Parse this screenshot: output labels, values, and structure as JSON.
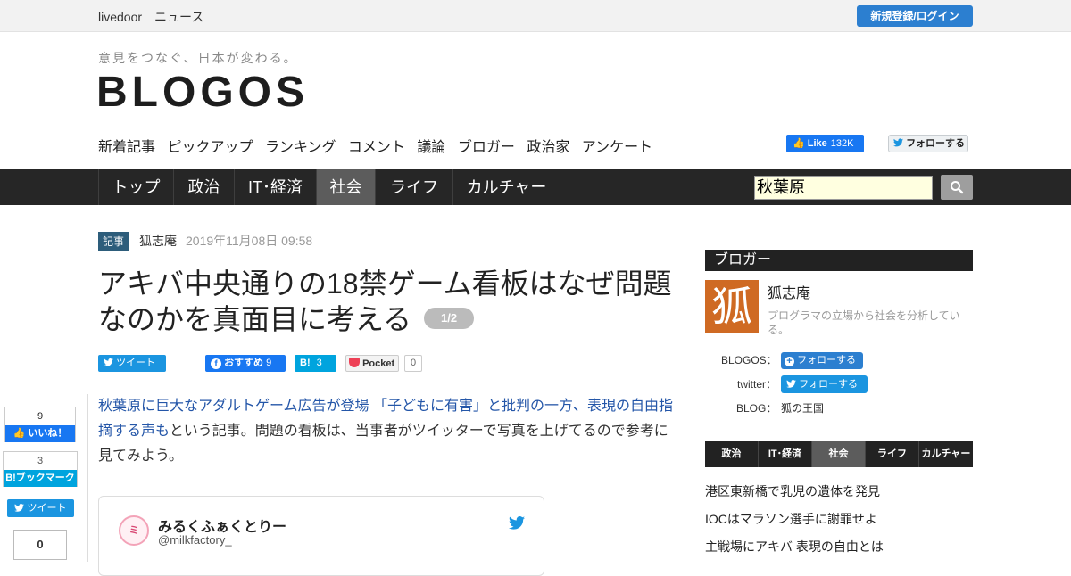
{
  "header": {
    "brand": "livedoor　ニュース",
    "login_label": "新規登録/ログイン",
    "tagline": "意見をつなぐ、日本が変わる。",
    "logo": "BLOGOS"
  },
  "subnav": [
    "新着記事",
    "ピックアップ",
    "ランキング",
    "コメント",
    "議論",
    "ブロガー",
    "政治家",
    "アンケート"
  ],
  "social": {
    "fb_like": "Like",
    "fb_count": "132K",
    "tw_follow": "フォローする"
  },
  "categories": [
    {
      "label": "トップ",
      "active": false
    },
    {
      "label": "政治",
      "active": false
    },
    {
      "label": "IT･経済",
      "active": false
    },
    {
      "label": "社会",
      "active": true
    },
    {
      "label": "ライフ",
      "active": false
    },
    {
      "label": "カルチャー",
      "active": false
    }
  ],
  "search": {
    "value": "秋葉原"
  },
  "article": {
    "tag": "記事",
    "author": "狐志庵",
    "date": "2019年11月08日 09:58",
    "title": "アキバ中央通りの18禁ゲーム看板はなぜ問題なのかを真面目に考える",
    "page": "1/2",
    "share": {
      "tweet": "ツイート",
      "fb_recommend": "おすすめ",
      "fb_count": "9",
      "hatena": "B!",
      "hatena_count": "3",
      "pocket": "Pocket",
      "pocket_count": "0"
    },
    "intro_link": "秋葉原に巨大なアダルトゲーム広告が登場 「子どもに有害」と批判の一方、表現の自由指摘する声も",
    "intro_text": "という記事。問題の看板は、当事者がツイッターで写真を上げてるので参考に見てみよう。"
  },
  "left_share": {
    "like_count": "9",
    "like_label": "いいね！",
    "hatena_count": "3",
    "hatena_label": "B!ブックマーク",
    "tweet_label": "ツイート",
    "pocket_count": "0"
  },
  "embed": {
    "name": "みるくふぁくとりー",
    "handle": "@milkfactory_"
  },
  "sidebar": {
    "heading": "ブロガー",
    "avatar_char": "狐",
    "blogger_name": "狐志庵",
    "description": "プログラマの立場から社会を分析している。",
    "blogos_label": "BLOGOS：",
    "blogos_follow": "フォローする",
    "twitter_label": "twitter：",
    "twitter_follow": "フォローする",
    "blog_label": "BLOG：",
    "blog_name": "狐の王国",
    "tabs": [
      {
        "label": "政治",
        "active": false
      },
      {
        "label": "IT･経済",
        "active": false
      },
      {
        "label": "社会",
        "active": true
      },
      {
        "label": "ライフ",
        "active": false
      },
      {
        "label": "カルチャー",
        "active": false
      }
    ],
    "news": [
      "港区東新橋で乳児の遺体を発見",
      "IOCはマラソン選手に謝罪せよ",
      "主戦場にアキバ 表現の自由とは"
    ]
  },
  "colors": {
    "accent_blue": "#2c7fd0",
    "nav_dark": "#262626",
    "fb_blue": "#1877f2",
    "twitter_blue": "#1b95e0",
    "hatena": "#00a4de",
    "pocket_red": "#ee4056",
    "avatar_orange": "#cf6a23"
  }
}
